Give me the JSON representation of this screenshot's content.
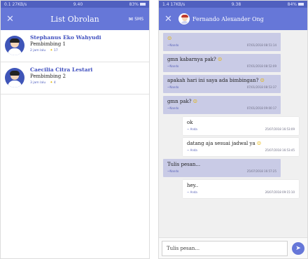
{
  "left": {
    "status": {
      "left": "0.1 27KB/s",
      "center": "9.40",
      "right": "83%"
    },
    "appbar": {
      "close_icon": "close-icon",
      "title": "List Obrolan",
      "action_label": "SMS"
    },
    "chats": [
      {
        "name": "Stephanus Eko Wahyudi",
        "subtitle": "Pembimbing 1",
        "time": "2 jam lalu",
        "count": "17"
      },
      {
        "name": "Caecilia Citra Lestari",
        "subtitle": "Pembimbing 2",
        "time": "3 jam lalu",
        "count": "4"
      }
    ]
  },
  "right": {
    "status": {
      "left": "1.4 17KB/s",
      "center": "9.38",
      "right": "84%"
    },
    "appbar": {
      "peer_name": "Fernando Alexander Ong"
    },
    "messages": [
      {
        "dir": "in",
        "text": "",
        "emoji": true,
        "sender": "~Nando",
        "time": "07/01/2018 08:51:14"
      },
      {
        "dir": "in",
        "text": "gmn kabarnya pak?",
        "emoji": true,
        "sender": "~Nando",
        "time": "07/01/2018 08:52:09"
      },
      {
        "dir": "in",
        "text": "apakah hari ini saya ada bimbingan?",
        "emoji": true,
        "sender": "~Nando",
        "time": "07/01/2018 08:53:37"
      },
      {
        "dir": "in",
        "text": "gmn pak?",
        "emoji": true,
        "sender": "~Nando",
        "time": "07/01/2018 09:00:17"
      },
      {
        "dir": "out",
        "text": "ok",
        "emoji": false,
        "sender": "~ Anda",
        "time": "25/07/2018 16:53:09"
      },
      {
        "dir": "out",
        "text": "datang aja sesuai jadwal ya",
        "emoji": true,
        "sender": "~ Anda",
        "time": "25/07/2018 16:53:45"
      },
      {
        "dir": "in",
        "text": "Tulis pesan...",
        "emoji": false,
        "sender": "~Nando",
        "time": "25/07/2018 16:57:25"
      },
      {
        "dir": "out",
        "text": "hey..",
        "emoji": false,
        "sender": "~ Anda",
        "time": "26/07/2018 09:15:10"
      }
    ],
    "composer": {
      "placeholder": "Tulis pesan..."
    }
  }
}
